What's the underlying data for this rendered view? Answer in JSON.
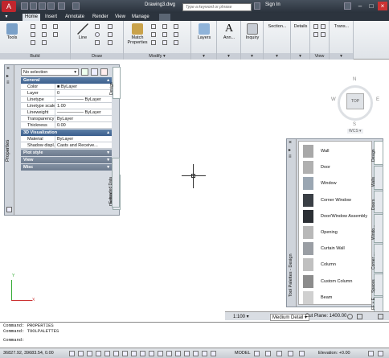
{
  "window": {
    "title": "Drawing3.dwg",
    "search_placeholder": "Type a keyword or phrase",
    "sign_in": "Sign In"
  },
  "ribbon_tabs": [
    "Home",
    "Insert",
    "Annotate",
    "Render",
    "View",
    "Manage"
  ],
  "ribbon": {
    "tools": "Tools",
    "build": "Build",
    "line": "Line",
    "draw": "Draw",
    "match_properties": "Match Properties",
    "modify": "Modify ▾",
    "layers": "Layers",
    "annotation": "Ann...",
    "inquiry": "Inquiry",
    "section": "Section...",
    "details": "Details",
    "view": "View",
    "trans": "Trans..."
  },
  "properties": {
    "selection": "No selection",
    "panel_title": "Properties",
    "tabs": [
      "Design",
      "Display",
      "Extended Data"
    ],
    "sections": {
      "general": "General",
      "visualization": "3D Visualization",
      "plot_style": "Plot style",
      "view": "View",
      "misc": "Misc"
    },
    "general": [
      {
        "key": "Color",
        "value": "■ ByLayer"
      },
      {
        "key": "Layer",
        "value": "0"
      },
      {
        "key": "Linetype",
        "value": "—————— ByLayer"
      },
      {
        "key": "Linetype scale",
        "value": "1.00"
      },
      {
        "key": "Lineweight",
        "value": "—————— ByLayer"
      },
      {
        "key": "Transparency",
        "value": "ByLayer"
      },
      {
        "key": "Thickness",
        "value": "0.00"
      }
    ],
    "visualization": [
      {
        "key": "Material",
        "value": "ByLayer"
      },
      {
        "key": "Shadow displ...",
        "value": "Casts and Receive..."
      }
    ]
  },
  "viewcube": {
    "n": "N",
    "s": "S",
    "e": "E",
    "w": "W",
    "top": "TOP",
    "wcs": "WCS ▾"
  },
  "tool_palette": {
    "title": "Tool Palettes - Design",
    "items": [
      "Wall",
      "Door",
      "Window",
      "Corner Window",
      "Door/Window Assembly",
      "Opening",
      "Curtain Wall",
      "Column",
      "Custom Column",
      "Beam"
    ],
    "tabs": [
      "Design",
      "Walls",
      "Doors",
      "Windo...",
      "Corner ...",
      "Spaces",
      "FF + E"
    ]
  },
  "statusbar_mid": {
    "scale": "1:100 ▾",
    "detail": "Medium Detail ▾",
    "cut_plane": "Cut Plane: 1400.00"
  },
  "commands": [
    "Command: PROPERTIES",
    "Command: TOOLPALETTES",
    "Command:"
  ],
  "statusbar": {
    "coords": "36827.92, 39683.54, 0.00",
    "model": "MODEL",
    "elevation": "Elevation: +0.00"
  }
}
